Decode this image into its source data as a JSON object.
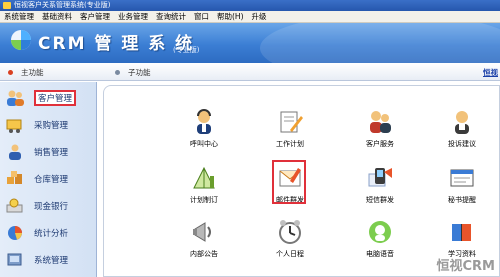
{
  "window": {
    "title": "恒视客户关系管理系统(专业版)"
  },
  "menubar": [
    "系统管理",
    "基础资料",
    "客户管理",
    "业务管理",
    "查询统计",
    "窗口",
    "帮助(H)",
    "升级"
  ],
  "banner": {
    "title": "CRM 管 理 系 统",
    "edition": "(专业版)"
  },
  "tabs": [
    {
      "label": "主功能",
      "dot_color": "#d94020"
    },
    {
      "label": "子功能",
      "dot_color": "#7a8aa0"
    }
  ],
  "tabbar_right_link": "恒视",
  "sidebar": [
    {
      "label": "客户管理",
      "icon": "people-icon",
      "active": true
    },
    {
      "label": "采购管理",
      "icon": "cart-icon",
      "active": false
    },
    {
      "label": "销售管理",
      "icon": "sales-icon",
      "active": false
    },
    {
      "label": "仓库管理",
      "icon": "warehouse-icon",
      "active": false
    },
    {
      "label": "现金银行",
      "icon": "bank-icon",
      "active": false
    },
    {
      "label": "统计分析",
      "icon": "pie-chart-icon",
      "active": false
    },
    {
      "label": "系统管理",
      "icon": "settings-icon",
      "active": false
    }
  ],
  "tiles": [
    {
      "label": "呼叫中心",
      "icon": "call-center-icon",
      "selected": false
    },
    {
      "label": "工作计划",
      "icon": "work-plan-icon",
      "selected": false
    },
    {
      "label": "客户服务",
      "icon": "customer-service-icon",
      "selected": false
    },
    {
      "label": "投诉建议",
      "icon": "complaint-icon",
      "selected": false
    },
    {
      "label": "计划制订",
      "icon": "plan-making-icon",
      "selected": false
    },
    {
      "label": "邮件群发",
      "icon": "mail-broadcast-icon",
      "selected": true
    },
    {
      "label": "短信群发",
      "icon": "sms-broadcast-icon",
      "selected": false
    },
    {
      "label": "秘书提醒",
      "icon": "secretary-reminder-icon",
      "selected": false
    },
    {
      "label": "内部公告",
      "icon": "announcement-icon",
      "selected": false
    },
    {
      "label": "个人日程",
      "icon": "schedule-icon",
      "selected": false
    },
    {
      "label": "电脑语音",
      "icon": "voice-icon",
      "selected": false
    },
    {
      "label": "学习资料",
      "icon": "study-material-icon",
      "selected": false
    }
  ],
  "watermark": "恒视CRM"
}
